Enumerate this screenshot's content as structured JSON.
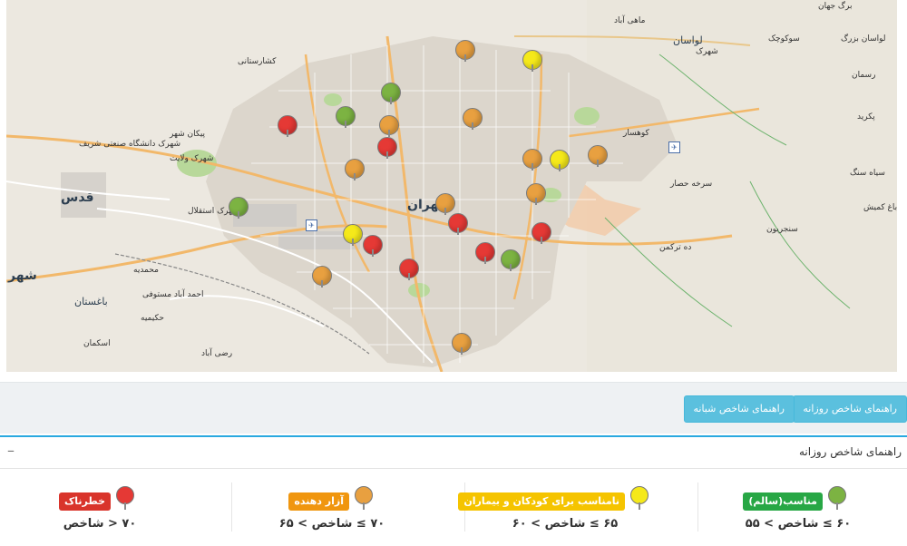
{
  "map": {
    "labels": [
      {
        "text": "برگ جهان",
        "cls": ""
      },
      {
        "text": "لواسان بزرگ",
        "cls": ""
      },
      {
        "text": "لواسان",
        "cls": "med"
      },
      {
        "text": "شهرک",
        "cls": ""
      },
      {
        "text": "سوکوچک",
        "cls": ""
      },
      {
        "text": "رسمان",
        "cls": ""
      },
      {
        "text": "پکرید",
        "cls": ""
      },
      {
        "text": "سیاه سنگ",
        "cls": ""
      },
      {
        "text": "باغ کمیش",
        "cls": ""
      },
      {
        "text": "سنجریون",
        "cls": ""
      },
      {
        "text": "ده ترکمن",
        "cls": ""
      },
      {
        "text": "قدس",
        "cls": "big"
      },
      {
        "text": "تهران",
        "cls": "big"
      },
      {
        "text": "باغستان",
        "cls": "med"
      },
      {
        "text": "شهر",
        "cls": "big"
      },
      {
        "text": "محمدیه",
        "cls": ""
      },
      {
        "text": "احمد آباد مستوفی",
        "cls": ""
      },
      {
        "text": "اسکمان",
        "cls": ""
      },
      {
        "text": "رضی آباد",
        "cls": ""
      },
      {
        "text": "شهرک ولایت",
        "cls": ""
      },
      {
        "text": "پیکان شهر",
        "cls": ""
      },
      {
        "text": "شهرک استقلال",
        "cls": ""
      },
      {
        "text": "شهرک دانشگاه صنعتی شریف",
        "cls": ""
      },
      {
        "text": "کشارستانی",
        "cls": ""
      },
      {
        "text": "کوهسار",
        "cls": ""
      },
      {
        "text": "ماهی آباد",
        "cls": ""
      },
      {
        "text": "حکیمیه",
        "cls": ""
      },
      {
        "text": "سرخه حصار",
        "cls": ""
      }
    ],
    "markers": [
      {
        "id": "st-1",
        "color": "#e8a040"
      },
      {
        "id": "st-2",
        "color": "#f5e91a"
      },
      {
        "id": "st-3",
        "color": "#7cb342"
      },
      {
        "id": "st-4",
        "color": "#e53935"
      },
      {
        "id": "st-5",
        "color": "#7cb342"
      },
      {
        "id": "st-6",
        "color": "#e8a040"
      },
      {
        "id": "st-7",
        "color": "#e8a040"
      },
      {
        "id": "st-8",
        "color": "#e53935"
      },
      {
        "id": "st-9",
        "color": "#e8a040"
      },
      {
        "id": "st-10",
        "color": "#e8a040"
      },
      {
        "id": "st-11",
        "color": "#f5e91a"
      },
      {
        "id": "st-12",
        "color": "#e8a040"
      },
      {
        "id": "st-13",
        "color": "#e8a040"
      },
      {
        "id": "st-14",
        "color": "#7cb342"
      },
      {
        "id": "st-15",
        "color": "#e8a040"
      },
      {
        "id": "st-16",
        "color": "#e53935"
      },
      {
        "id": "st-17",
        "color": "#e53935"
      },
      {
        "id": "st-18",
        "color": "#f5e91a"
      },
      {
        "id": "st-19",
        "color": "#e53935"
      },
      {
        "id": "st-20",
        "color": "#e53935"
      },
      {
        "id": "st-21",
        "color": "#7cb342"
      },
      {
        "id": "st-22",
        "color": "#e53935"
      },
      {
        "id": "st-23",
        "color": "#e8a040"
      },
      {
        "id": "st-24",
        "color": "#e8a040"
      }
    ]
  },
  "toolbar": {
    "daily_guide": "راهنمای شاخص روزانه",
    "night_guide": "راهنمای شاخص شبانه"
  },
  "panel": {
    "title": "راهنمای شاخص روزانه",
    "collapse_symbol": "–",
    "legend": [
      {
        "label": "مناسب(سالم)",
        "range": "۶۰ ≥ شاخص > ۵۵",
        "color": "#7cb342",
        "badge_color": "#28a745"
      },
      {
        "label": "نامناسب برای کودکان و بیماران",
        "range": "۶۵ ≥ شاخص > ۶۰",
        "color": "#f5e91a",
        "badge_color": "#f5c400"
      },
      {
        "label": "آزار دهنده",
        "range": "۷۰ ≥ شاخص > ۶۵",
        "color": "#e8a040",
        "badge_color": "#f0960f"
      },
      {
        "label": "خطرناک",
        "range": "۷۰ < شاخص",
        "color": "#e53935",
        "badge_color": "#d9342b"
      }
    ]
  }
}
